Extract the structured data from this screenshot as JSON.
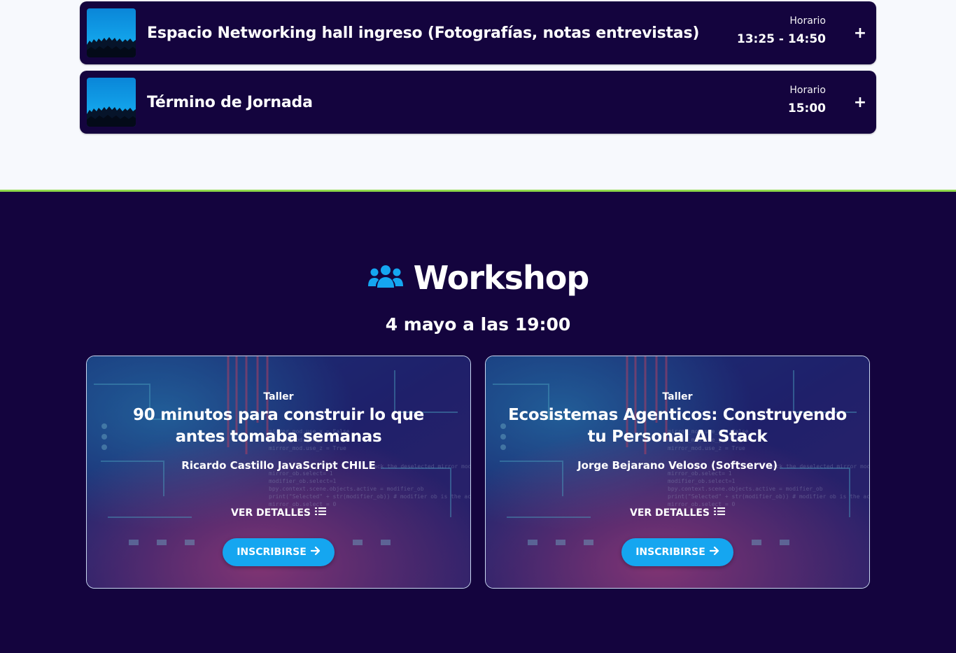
{
  "agenda": [
    {
      "title": "Espacio Networking hall ingreso (Fotografías, notas entrevistas)",
      "time_label": "Horario",
      "time": "13:25 - 14:50"
    },
    {
      "title": "Término de Jornada",
      "time_label": "Horario",
      "time": "15:00"
    }
  ],
  "workshop": {
    "title": "Workshop",
    "subtitle": "4 mayo a las 19:00",
    "icon": "users-icon",
    "cards": [
      {
        "tag": "Taller",
        "title": "90 minutos para construir lo que antes tomaba semanas",
        "speaker": "Ricardo Castillo JavaScript CHILE",
        "details_label": "VER DETALLES",
        "register_label": "INSCRIBIRSE"
      },
      {
        "tag": "Taller",
        "title": "Ecosistemas Agenticos: Construyendo tu Personal AI Stack",
        "speaker": "Jorge Bejarano Veloso (Softserve)",
        "details_label": "VER DETALLES",
        "register_label": "INSCRIBIRSE"
      }
    ]
  },
  "colors": {
    "navy": "#14043e",
    "accent_blue": "#15a6f0",
    "divider_green": "#8fd94a"
  }
}
